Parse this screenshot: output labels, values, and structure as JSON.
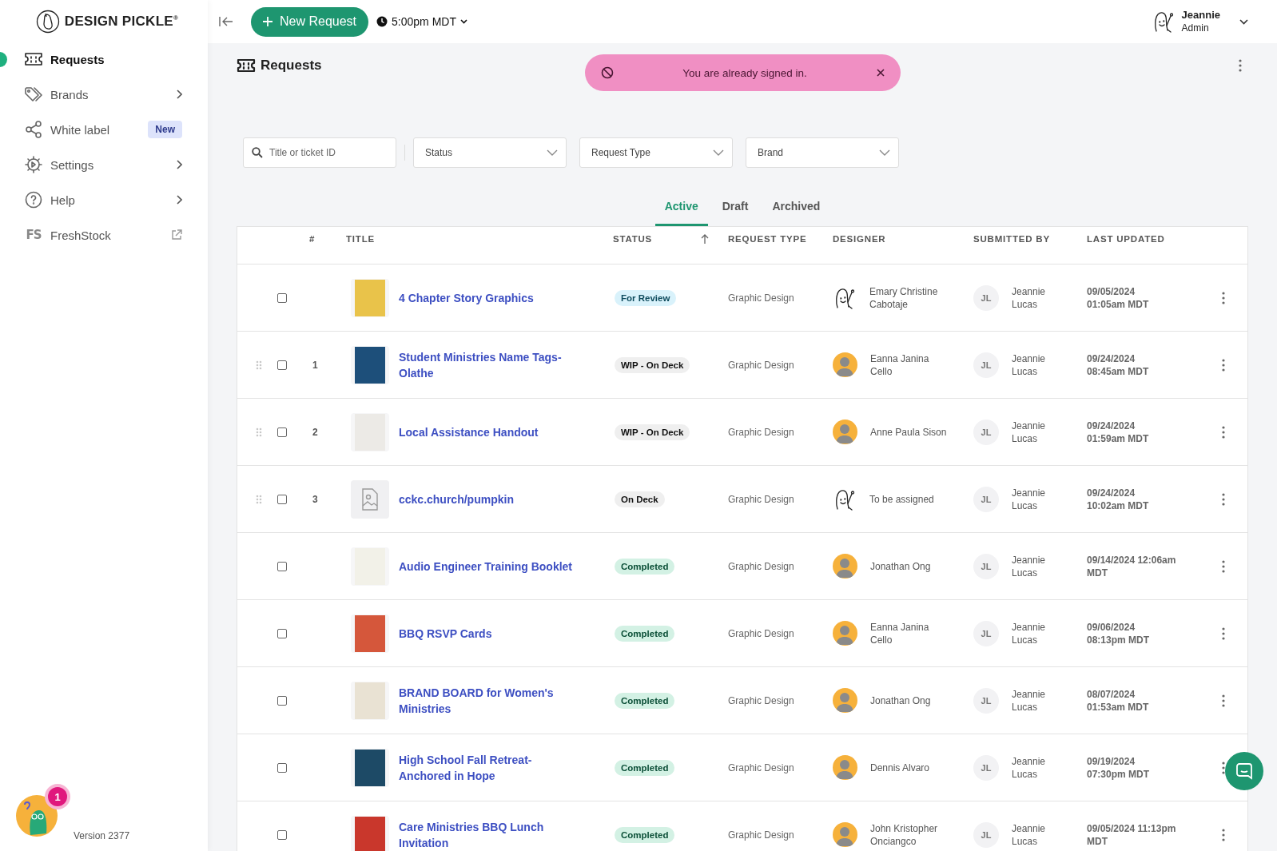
{
  "sidebar": {
    "logo": "DESIGN PICKLE$^{®}$",
    "items": [
      {
        "label": "Requests",
        "selected": true,
        "kind": "plain"
      },
      {
        "label": "Brands",
        "selected": false,
        "kind": "submenu"
      },
      {
        "label": "White label",
        "selected": false,
        "kind": "badge",
        "badge": "New"
      },
      {
        "label": "Settings",
        "selected": false,
        "kind": "submenu"
      },
      {
        "label": "Help",
        "selected": false,
        "kind": "submenu"
      },
      {
        "label": "FreshStock",
        "selected": false,
        "kind": "external",
        "icon_text": "FS"
      }
    ],
    "help_widget": {
      "badge": "1"
    },
    "version": "Version 2377"
  },
  "topbar": {
    "new_request": "New Request",
    "time": "5:00pm MDT",
    "user": {
      "name": "Jeannie",
      "role": "Admin"
    }
  },
  "page": {
    "title": "Requests"
  },
  "toast": {
    "message": "You are already signed in."
  },
  "filters": {
    "search": {
      "placeholder": "Title or ticket ID"
    },
    "dropdowns": [
      {
        "placeholder": "Status"
      },
      {
        "placeholder": "Request Type"
      },
      {
        "placeholder": "Brand"
      }
    ]
  },
  "tabs": [
    {
      "label": "Active",
      "selected": true
    },
    {
      "label": "Draft",
      "selected": false
    },
    {
      "label": "Archived",
      "selected": false
    }
  ],
  "table": {
    "columns": [
      {
        "label": "#",
        "sorted": false
      },
      {
        "label": "TITLE",
        "sorted": false
      },
      {
        "label": "STATUS",
        "sorted": true
      },
      {
        "label": "REQUEST TYPE",
        "sorted": false
      },
      {
        "label": "DESIGNER",
        "sorted": false
      },
      {
        "label": "SUBMITTED BY",
        "sorted": false
      },
      {
        "label": "LAST UPDATED",
        "sorted": false
      }
    ],
    "rows": [
      {
        "draggable": false,
        "checked": false,
        "thumbnail": {
          "kind": "image"
        },
        "title": "4 Chapter Story Graphics",
        "status": {
          "label": "For Review",
          "kind": "review"
        },
        "request_type": "Graphic Design",
        "designer": {
          "name": "Emary Christine Cabotaje",
          "kind": "sketch"
        },
        "submitted_by": {
          "initials": "JL",
          "name": "Jeannie Lucas"
        },
        "last_updated": "09/05/2024\n01:05am MDT"
      },
      {
        "draggable": true,
        "checked": false,
        "number": "1",
        "thumbnail": {
          "kind": "image"
        },
        "title": "Student Ministries Name Tags-Olathe",
        "status": {
          "label": "WIP - On Deck",
          "kind": "queued"
        },
        "request_type": "Graphic Design",
        "designer": {
          "name": "Eanna Janina Cello",
          "kind": "photo"
        },
        "submitted_by": {
          "initials": "JL",
          "name": "Jeannie Lucas"
        },
        "last_updated": "09/24/2024\n08:45am MDT"
      },
      {
        "draggable": true,
        "checked": false,
        "number": "2",
        "thumbnail": {
          "kind": "image"
        },
        "title": "Local Assistance Handout",
        "status": {
          "label": "WIP - On Deck",
          "kind": "queued"
        },
        "request_type": "Graphic Design",
        "designer": {
          "name": "Anne Paula Sison",
          "kind": "photo"
        },
        "submitted_by": {
          "initials": "JL",
          "name": "Jeannie Lucas"
        },
        "last_updated": "09/24/2024\n01:59am MDT"
      },
      {
        "draggable": true,
        "checked": false,
        "number": "3",
        "thumbnail": {
          "kind": "placeholder"
        },
        "title": "cckc.church/pumpkin",
        "status": {
          "label": "On Deck",
          "kind": "queued"
        },
        "request_type": "Graphic Design",
        "designer": {
          "name": "To be assigned",
          "kind": "sketch"
        },
        "submitted_by": {
          "initials": "JL",
          "name": "Jeannie Lucas"
        },
        "last_updated": "09/24/2024\n10:02am MDT"
      },
      {
        "draggable": false,
        "checked": false,
        "thumbnail": {
          "kind": "image"
        },
        "title": "Audio Engineer Training Booklet",
        "status": {
          "label": "Completed",
          "kind": "completed"
        },
        "request_type": "Graphic Design",
        "designer": {
          "name": "Jonathan Ong",
          "kind": "photo"
        },
        "submitted_by": {
          "initials": "JL",
          "name": "Jeannie Lucas"
        },
        "last_updated": "09/14/2024 12:06am MDT"
      },
      {
        "draggable": false,
        "checked": false,
        "thumbnail": {
          "kind": "image"
        },
        "title": "BBQ RSVP Cards",
        "status": {
          "label": "Completed",
          "kind": "completed"
        },
        "request_type": "Graphic Design",
        "designer": {
          "name": "Eanna Janina Cello",
          "kind": "photo"
        },
        "submitted_by": {
          "initials": "JL",
          "name": "Jeannie Lucas"
        },
        "last_updated": "09/06/2024\n08:13pm MDT"
      },
      {
        "draggable": false,
        "checked": false,
        "thumbnail": {
          "kind": "image"
        },
        "title": "BRAND BOARD for Women's Ministries",
        "status": {
          "label": "Completed",
          "kind": "completed"
        },
        "request_type": "Graphic Design",
        "designer": {
          "name": "Jonathan Ong",
          "kind": "photo"
        },
        "submitted_by": {
          "initials": "JL",
          "name": "Jeannie Lucas"
        },
        "last_updated": "08/07/2024\n01:53am MDT"
      },
      {
        "draggable": false,
        "checked": false,
        "thumbnail": {
          "kind": "image"
        },
        "title": "High School Fall Retreat-Anchored in Hope",
        "status": {
          "label": "Completed",
          "kind": "completed"
        },
        "request_type": "Graphic Design",
        "designer": {
          "name": "Dennis Alvaro",
          "kind": "photo"
        },
        "submitted_by": {
          "initials": "JL",
          "name": "Jeannie Lucas"
        },
        "last_updated": "09/19/2024\n07:30pm MDT"
      },
      {
        "draggable": false,
        "checked": false,
        "thumbnail": {
          "kind": "image"
        },
        "title": "Care Ministries BBQ Lunch Invitation",
        "status": {
          "label": "Completed",
          "kind": "completed"
        },
        "request_type": "Graphic Design",
        "designer": {
          "name": "John Kristopher Onciangco",
          "kind": "photo"
        },
        "submitted_by": {
          "initials": "JL",
          "name": "Jeannie Lucas"
        },
        "last_updated": "09/05/2024 11:13pm MDT"
      }
    ]
  }
}
